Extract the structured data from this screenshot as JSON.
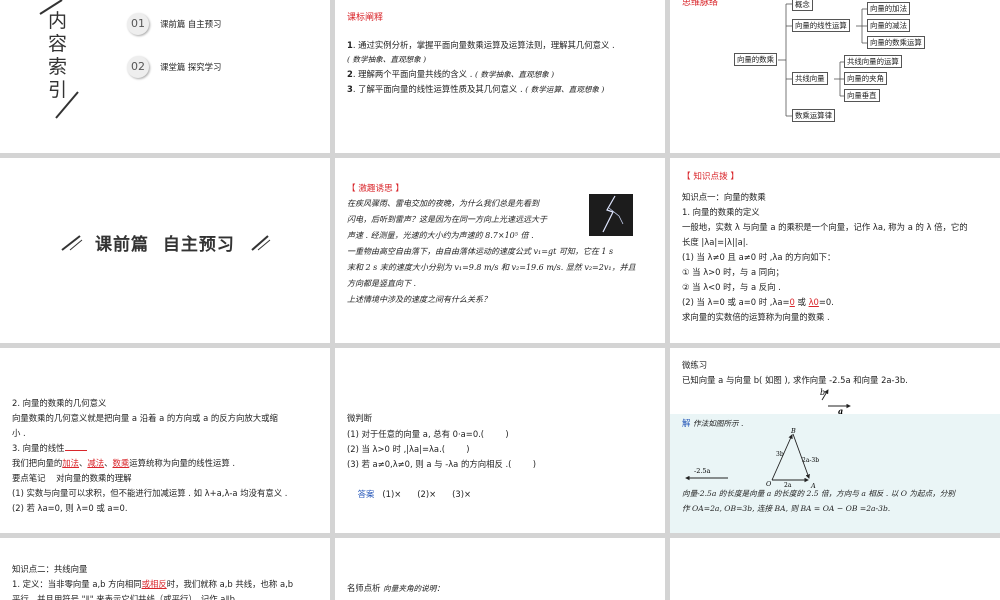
{
  "s1": {
    "title_chars": [
      "内",
      "容",
      "索",
      "引"
    ],
    "items": [
      {
        "num": "01",
        "text": "课前篇  自主预习"
      },
      {
        "num": "02",
        "text": "课堂篇  探究学习"
      }
    ]
  },
  "s2": {
    "heading": "课标阐释",
    "lines": [
      {
        "n": "1",
        "text": ". 通过实例分析，掌握平面向量数乘运算及运算法则，理解其几何意义 .",
        "note": "( 数学抽象、直观想象 )"
      },
      {
        "n": "2",
        "text": ". 理解两个平面向量共线的含义 .",
        "note": "( 数学抽象、直观想象 )"
      },
      {
        "n": "3",
        "text": ". 了解平面向量的线性运算性质及其几何意义 .",
        "note": "( 数学运算、直观想象 )"
      }
    ]
  },
  "s3": {
    "heading": "思维脉络",
    "root": "向量的数乘",
    "b1": "概念",
    "b2": "向量的线性运算",
    "b3": "共线向量",
    "b4": "数乘运算律",
    "leaves2": [
      "向量的加法",
      "向量的减法",
      "向量的数乘运算"
    ],
    "leaves3": [
      "共线向量的运算",
      "向量的夹角",
      "向量垂直"
    ]
  },
  "s4": {
    "title": "课前篇  自主预习"
  },
  "s5": {
    "heading": "【 激趣诱思 】",
    "lines": [
      "在疾风骤雨、雷电交加的夜晚，为什么我们总是先看到",
      "闪电，后听到雷声？这是因为在同一方向上光速远远大于",
      "声速 . 经测量，光速的大小约为声速的 8.7×10⁵ 倍 .",
      "一重物由高空自由落下，由自由落体运动的速度公式 v₁=gt 可知，它在 1 s",
      "末和 2 s 末的速度大小分别为 v₁=9.8 m/s 和 v₂=19.6 m/s. 显然 v₂=2v₁，并且",
      "方向都是竖直向下 .",
      "上述情境中涉及的速度之间有什么关系？"
    ]
  },
  "s6": {
    "heading": "【 知识点拨 】",
    "lines": [
      "知识点一：向量的数乘",
      "1. 向量的数乘的定义",
      "一般地，实数 λ 与向量 a 的乘积是一个向量，记作 λa, 称为 a 的 λ 倍，它的",
      "长度 |λa|=|λ||a|.",
      "(1) 当 λ≠0 且 a≠0 时 ,λa 的方向如下：",
      "① 当 λ>0 时，与 a 同向；",
      "② 当 λ<0 时，与 a 反向 .",
      "(2) 当 λ=0 或 a=0 时 ,λa=",
      "求向量的实数倍的运算称为向量的数乘 ."
    ],
    "blank1": "0",
    "mid": " 或 ",
    "blank2": "λ0",
    "tail": "=0."
  },
  "s7": {
    "lines": [
      "2. 向量的数乘的几何意义",
      "向量数乘的几何意义就是把向量 a 沿着 a 的方向或 a 的反方向放大或缩",
      "小 .",
      "3. 向量的线性",
      "我们把向量的",
      "要点笔记    对向量的数乘的理解",
      "(1) 实数与向量可以求积，但不能进行加减运算 . 如 λ+a,λ-a 均没有意义 .",
      "(2) 若 λa=0, 则 λ=0 或 a=0."
    ],
    "underlined": [
      "加法",
      "减法",
      "数乘"
    ],
    "after": "运算统称为向量的线性运算 ."
  },
  "s8": {
    "heading": "微判断",
    "lines": [
      "(1) 对于任意的向量 a, 总有 0·a=0.(        )",
      "(2) 当 λ>0 时 ,|λa|=λa.(        )",
      "(3) 若 a≠0,λ≠0, 则 a 与 -λa 的方向相反 .(        )"
    ],
    "answer_label": "答案",
    "answer": "(1)×      (2)×      (3)×"
  },
  "s9": {
    "heading": "微练习",
    "question": "已知向量 a 与向量 b( 如图 ), 求作向量 -2.5a 和向量 2a-3b.",
    "sol_label": "解",
    "sol_intro": "作法如图所示 .",
    "labels": {
      "b": "b",
      "a": "a",
      "B": "B",
      "A": "A",
      "O": "O",
      "v3b": "3b",
      "v2a3b": "2a-3b",
      "v2a": "2a",
      "neg": "-2.5a"
    },
    "sol_lines": [
      "向量-2.5a 的长度是向量 a 的长度的 2.5 倍，方向与 a 相反 . 以 O 为起点，分别",
      "作 OA=2a, OB=3b, 连接 BA, 则 BA = OA − OB =2a-3b."
    ]
  },
  "s10": {
    "lines": [
      "知识点二：共线向量",
      "1. 定义：当非零向量 a,b 方向相同",
      "平行，并且用符号 \"∥\" 来表示它们共线（或平行），记作 a∥b."
    ],
    "blank": "或",
    "red": "相反",
    "tail": "时，我们就称 a,b 共线，也称 a,b"
  },
  "s11": {
    "label": "名师点析",
    "text": "向量夹角的说明："
  }
}
